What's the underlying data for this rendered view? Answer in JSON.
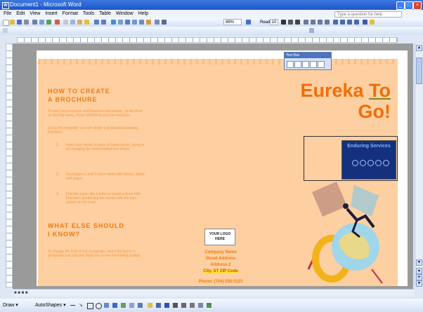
{
  "window": {
    "title": "Document1 - Microsoft Word"
  },
  "menu": [
    "File",
    "Edit",
    "View",
    "Insert",
    "Format",
    "Tools",
    "Table",
    "Window",
    "Help"
  ],
  "help_box": {
    "placeholder": "Type a question for help"
  },
  "toolbar": {
    "zoom": "88%",
    "read_label": "Read",
    "style_size": "10"
  },
  "floating_toolbox": {
    "title": "Text Box"
  },
  "brochure": {
    "heading1": [
      "HOW TO CREATE",
      "A BROCHURE"
    ],
    "intro1": "To print your brochure and brochure instructions, on the Print on the File menu. Press ENTER to print the brochure.",
    "intro2": "Using this template, you can create a professional-looking brochure.",
    "items": [
      "Insert your words in place of these words, using or by changing the preformatted text shown.",
      "Find pages 1 and 2 you're done with blocks, slides and pages.",
      "Fold the paper like a letter to create a three-fold brochure, positioning the panels with the logo picture on the front."
    ],
    "heading2": [
      "WHAT ELSE SHOULD",
      "I KNOW?"
    ],
    "outro": "To change the look of any paragraph, select the text in a paragraph and click the Style box on the Formatting toolbar.",
    "title_word1": "Eureka",
    "title_word2": "To",
    "title_line2": "Go!",
    "panel_label": "Enduring Services",
    "logo_line1": "YOUR LOGO",
    "logo_line2": "HERE",
    "address": [
      "Company Name",
      "Street Address",
      "Address 2",
      "City, ST ZIP Code"
    ],
    "phone": "Phone: (704) 555-0123"
  },
  "drawbar": {
    "draw_label": "Draw ▾",
    "autoshapes_label": "AutoShapes ▾"
  },
  "icons": [
    "app-icon",
    "new-icon",
    "open-icon",
    "save-icon",
    "print-icon",
    "bold-icon",
    "italic-icon",
    "underline-icon",
    "font-color-icon",
    "line-icon",
    "arrow-icon",
    "rectangle-icon",
    "oval-icon"
  ],
  "colors": {
    "brochure_bg": "#fecfa0",
    "heading_orange": "#f07a12",
    "panel_blue": "#15307d",
    "title_bar": "#1d56c9"
  }
}
